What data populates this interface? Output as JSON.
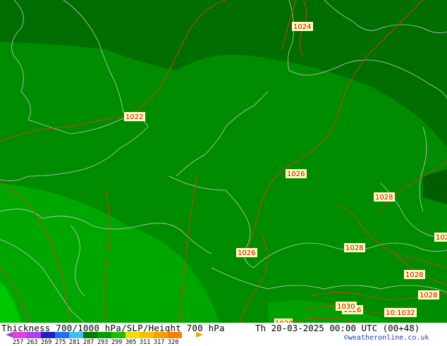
{
  "map": {
    "isobar_labels": [
      "1024",
      "1022",
      "1026",
      "1028",
      "1028",
      "1026",
      "1028",
      "1028",
      "1026",
      "1030",
      "1028",
      "10:1032",
      "102"
    ]
  },
  "footer": {
    "title": "Thickness 700/1000 hPa/SLP/Height 700 hPa",
    "datetime": "Th 20-03-2025 00:00 UTC (00+48)",
    "credit": "©weatheronline.co.uk",
    "scale_values": [
      "257",
      "263",
      "269",
      "275",
      "281",
      "287",
      "293",
      "299",
      "305",
      "311",
      "317",
      "320"
    ],
    "scale_colors": [
      "#e040e0",
      "#b040f0",
      "#2020c0",
      "#2070f0",
      "#40c0f0",
      "#007a00",
      "#00a000",
      "#20c000",
      "#f0e000",
      "#f8c000",
      "#f8a000",
      "#f88000"
    ]
  },
  "colors": {
    "dark_green": "#006e00",
    "mid_green": "#008c00",
    "light_green": "#00a600",
    "bright_green": "#00c800",
    "isobar": "#d04020",
    "coast": "#c8c8c8"
  }
}
